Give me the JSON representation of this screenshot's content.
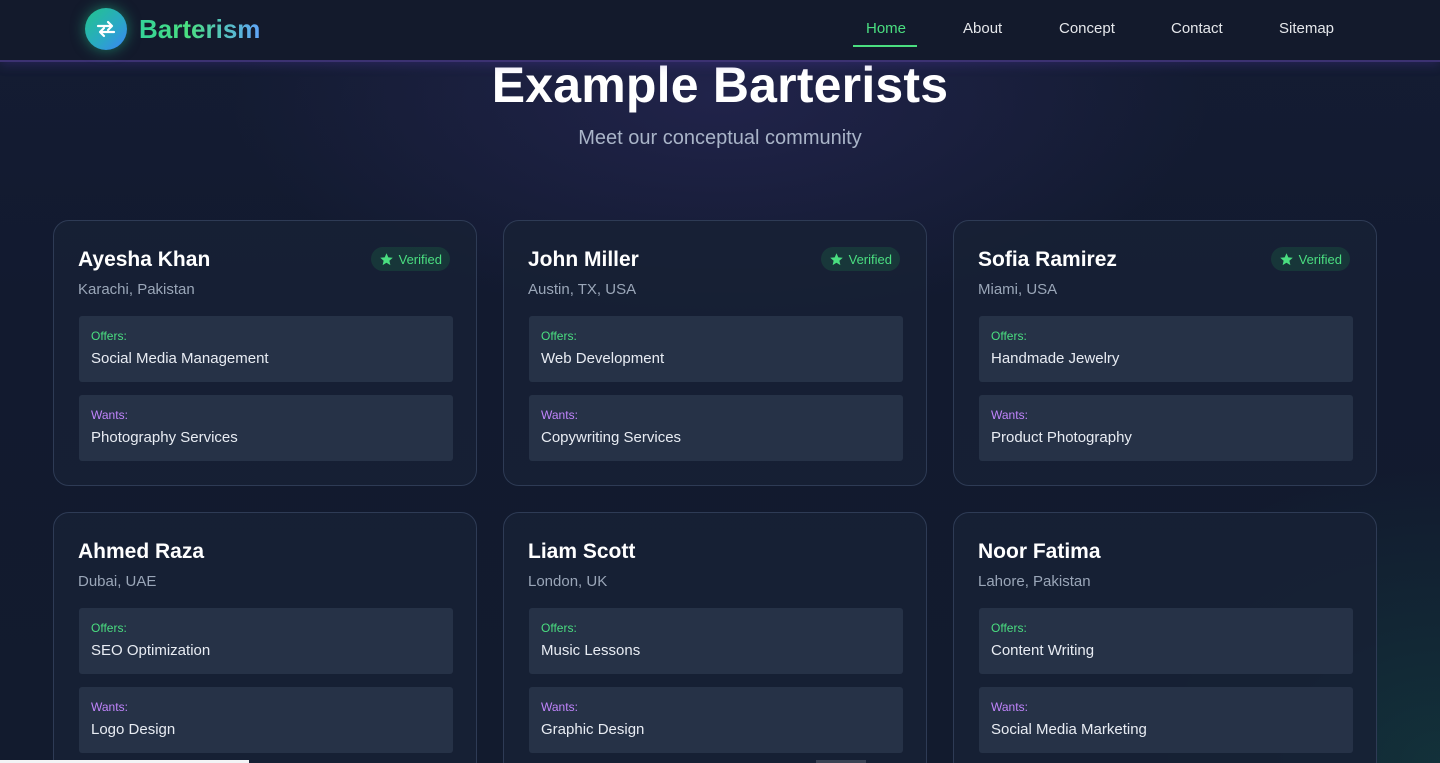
{
  "brand": {
    "name": "Barterism",
    "logo_icon": "swap-arrows-icon",
    "accent": "#4ade80"
  },
  "nav": {
    "items": [
      {
        "label": "Home",
        "active": true
      },
      {
        "label": "About",
        "active": false
      },
      {
        "label": "Concept",
        "active": false
      },
      {
        "label": "Contact",
        "active": false
      },
      {
        "label": "Sitemap",
        "active": false
      }
    ]
  },
  "hero": {
    "title": "Example Barterists",
    "subtitle": "Meet our conceptual community"
  },
  "labels": {
    "offers": "Offers:",
    "wants": "Wants:"
  },
  "cards": [
    {
      "name": "Ayesha Khan",
      "location": "Karachi, Pakistan",
      "verified": "Verified",
      "offers": "Social Media Management",
      "wants": "Photography Services"
    },
    {
      "name": "John Miller",
      "location": "Austin, TX, USA",
      "verified": "Verified",
      "offers": "Web Development",
      "wants": "Copywriting Services"
    },
    {
      "name": "Sofia Ramirez",
      "location": "Miami, USA",
      "verified": "Verified",
      "offers": "Handmade Jewelry",
      "wants": "Product Photography"
    },
    {
      "name": "Ahmed Raza",
      "location": "Dubai, UAE",
      "offers": "SEO Optimization",
      "wants": "Logo Design"
    },
    {
      "name": "Liam Scott",
      "location": "London, UK",
      "offers": "Music Lessons",
      "wants": "Graphic Design"
    },
    {
      "name": "Noor Fatima",
      "location": "Lahore, Pakistan",
      "offers": "Content Writing",
      "wants": "Social Media Marketing"
    }
  ],
  "colors": {
    "offers_label": "#4ade80",
    "wants_label": "#c084fc",
    "badge_text": "#4ade80"
  }
}
